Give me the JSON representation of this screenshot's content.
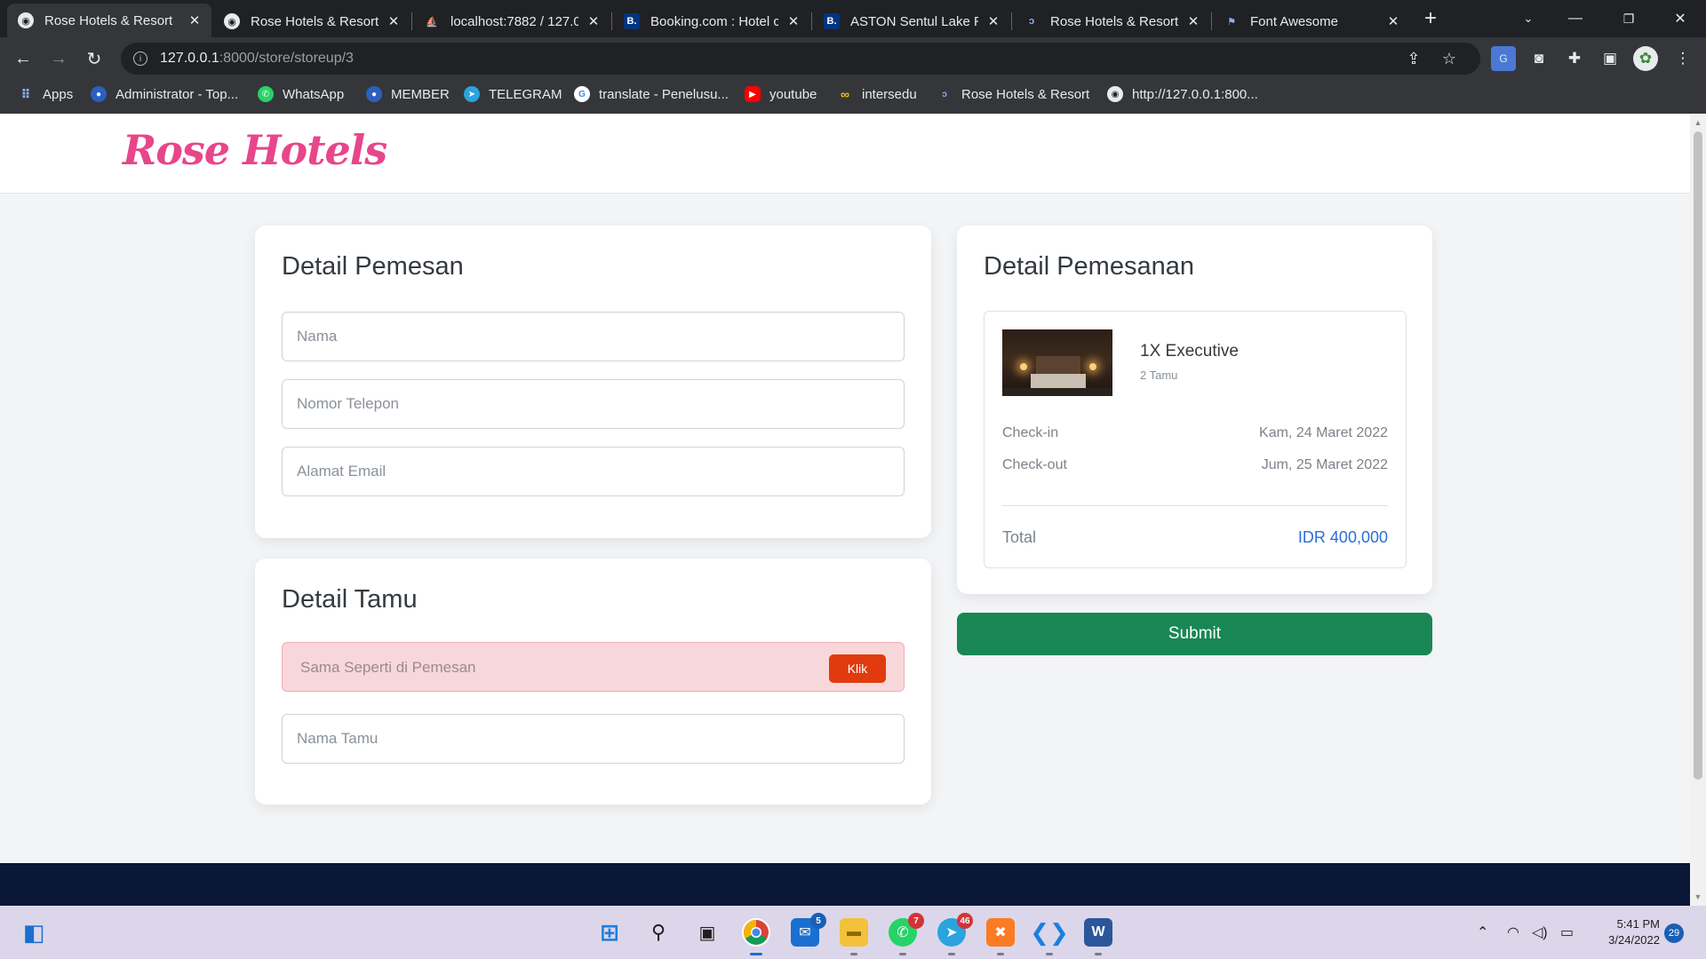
{
  "browser": {
    "tabs": [
      {
        "label": "Rose Hotels & Resort",
        "active": true,
        "icon": "globe-icon"
      },
      {
        "label": "Rose Hotels & Resort",
        "active": false,
        "icon": "globe-icon"
      },
      {
        "label": "localhost:7882 / 127.0",
        "active": false,
        "icon": "phpmyadmin-icon"
      },
      {
        "label": "Booking.com : Hotel c",
        "active": false,
        "icon": "booking-icon"
      },
      {
        "label": "ASTON Sentul Lake Re",
        "active": false,
        "icon": "booking-icon"
      },
      {
        "label": "Rose Hotels & Resort",
        "active": false,
        "icon": "rose-icon"
      },
      {
        "label": "Font Awesome",
        "active": false,
        "icon": "flag-icon"
      }
    ],
    "url_host": "127.0.0.1",
    "url_path": ":8000/store/storeup/3",
    "bookmarks": [
      {
        "label": "Apps",
        "icon": "apps-grid-icon"
      },
      {
        "label": "Administrator - Top...",
        "icon": "admin-icon"
      },
      {
        "label": "WhatsApp",
        "icon": "whatsapp-icon"
      },
      {
        "label": "MEMBER",
        "icon": "member-icon"
      },
      {
        "label": "TELEGRAM",
        "icon": "telegram-icon"
      },
      {
        "label": "translate - Penelusu...",
        "icon": "google-icon"
      },
      {
        "label": "youtube",
        "icon": "youtube-icon"
      },
      {
        "label": "intersedu",
        "icon": "intersedu-icon"
      },
      {
        "label": "Rose Hotels & Resort",
        "icon": "rose-icon"
      },
      {
        "label": "http://127.0.0.1:800...",
        "icon": "globe-icon"
      }
    ]
  },
  "site": {
    "brand": "Rose Hotels"
  },
  "pemesan": {
    "title": "Detail Pemesan",
    "nama_placeholder": "Nama",
    "telepon_placeholder": "Nomor Telepon",
    "email_placeholder": "Alamat Email"
  },
  "tamu": {
    "title": "Detail Tamu",
    "same_label": "Sama Seperti di Pemesan",
    "klik_label": "Klik",
    "nama_tamu_placeholder": "Nama Tamu"
  },
  "pemesanan": {
    "title": "Detail Pemesanan",
    "room": "1X Executive",
    "guests": "2 Tamu",
    "checkin_label": "Check-in",
    "checkin_value": "Kam, 24 Maret 2022",
    "checkout_label": "Check-out",
    "checkout_value": "Jum, 25 Maret 2022",
    "total_label": "Total",
    "total_value": "IDR 400,000",
    "submit_label": "Submit"
  },
  "taskbar": {
    "badges": {
      "mail": "5",
      "whatsapp": "7",
      "telegram": "46"
    },
    "time": "5:41 PM",
    "date": "3/24/2022",
    "notifications": "29"
  },
  "colors": {
    "brand": "#e8468a",
    "submit": "#198754",
    "klik": "#e13a0e",
    "total": "#2a6fd6",
    "footer": "#0a1736"
  }
}
